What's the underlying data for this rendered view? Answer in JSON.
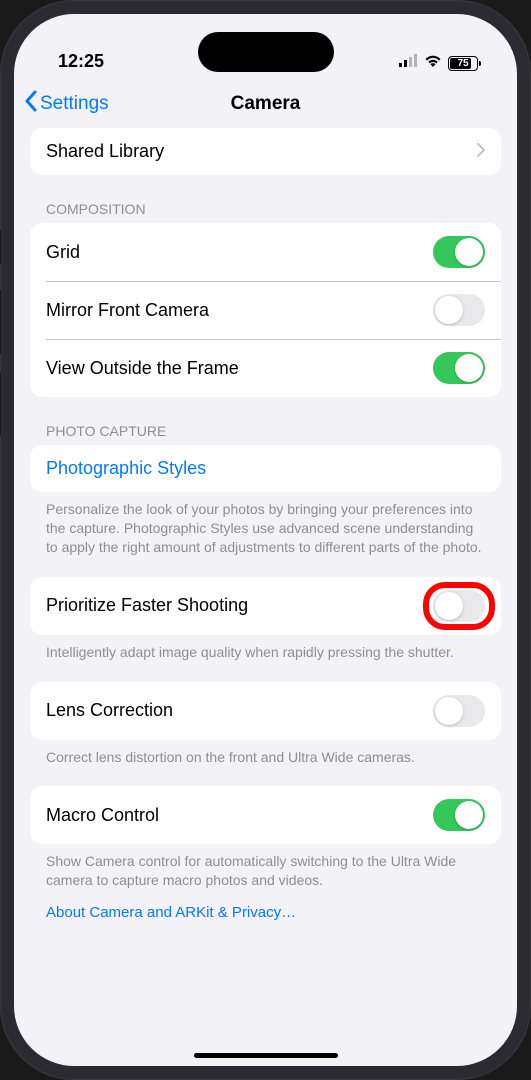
{
  "status": {
    "time": "12:25",
    "battery_percent": "75"
  },
  "nav": {
    "back_label": "Settings",
    "title": "Camera"
  },
  "shared_library": {
    "label": "Shared Library"
  },
  "composition": {
    "header": "COMPOSITION",
    "grid": {
      "label": "Grid",
      "on": true
    },
    "mirror_front": {
      "label": "Mirror Front Camera",
      "on": false
    },
    "view_outside": {
      "label": "View Outside the Frame",
      "on": true
    }
  },
  "photo_capture": {
    "header": "PHOTO CAPTURE",
    "styles": {
      "label": "Photographic Styles",
      "footer": "Personalize the look of your photos by bringing your preferences into the capture. Photographic Styles use advanced scene understanding to apply the right amount of adjustments to different parts of the photo."
    },
    "faster_shooting": {
      "label": "Prioritize Faster Shooting",
      "on": false,
      "footer": "Intelligently adapt image quality when rapidly pressing the shutter."
    },
    "lens_correction": {
      "label": "Lens Correction",
      "on": false,
      "footer": "Correct lens distortion on the front and Ultra Wide cameras."
    },
    "macro_control": {
      "label": "Macro Control",
      "on": true,
      "footer": "Show Camera control for automatically switching to the Ultra Wide camera to capture macro photos and videos."
    }
  },
  "privacy_link": "About Camera and ARKit & Privacy…"
}
